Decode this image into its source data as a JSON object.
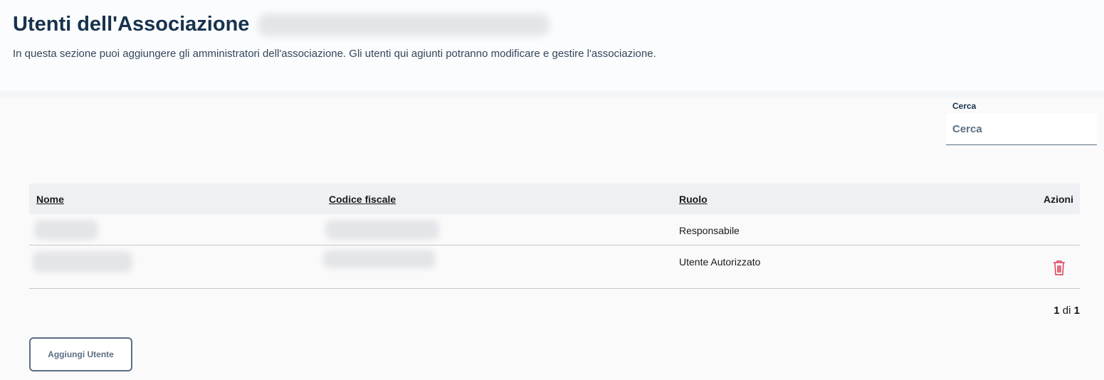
{
  "header": {
    "title": "Utenti dell'Associazione",
    "subtitle": "In questa sezione puoi aggiungere gli amministratori dell'associazione. Gli utenti qui agiunti potranno modificare e gestire l'associazione."
  },
  "search": {
    "label": "Cerca",
    "placeholder": "Cerca"
  },
  "table": {
    "columns": [
      "Nome",
      "Codice fiscale",
      "Ruolo",
      "Azioni"
    ],
    "rows": [
      {
        "ruolo": "Responsabile",
        "actions": []
      },
      {
        "ruolo": "Utente Autorizzato",
        "actions": [
          "trash-icon"
        ]
      }
    ]
  },
  "pagination": {
    "current": "1",
    "separator": "di",
    "total": "1"
  },
  "actions": {
    "add_user_label": "Aggiungi Utente"
  },
  "colors": {
    "title": "#17324d",
    "accent": "#5c6f82",
    "danger": "#d9364f",
    "table_header_bg": "#eef0f3"
  }
}
